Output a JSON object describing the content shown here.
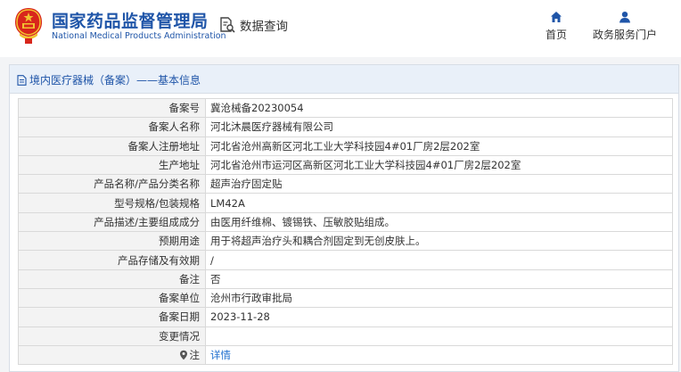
{
  "header": {
    "brand_cn": "国家药品监督管理局",
    "brand_en": "National Medical Products Administration",
    "query_label": "数据查询",
    "nav": [
      {
        "label": "首页",
        "icon": "home-icon"
      },
      {
        "label": "政务服务门户",
        "icon": "user-icon"
      }
    ]
  },
  "panel": {
    "title": "境内医疗器械（备案）——基本信息",
    "rows": [
      {
        "label": "备案号",
        "value": "冀沧械备20230054"
      },
      {
        "label": "备案人名称",
        "value": "河北沐晨医疗器械有限公司"
      },
      {
        "label": "备案人注册地址",
        "value": "河北省沧州高新区河北工业大学科技园4#01厂房2层202室"
      },
      {
        "label": "生产地址",
        "value": "河北省沧州市运河区高新区河北工业大学科技园4#01厂房2层202室"
      },
      {
        "label": "产品名称/产品分类名称",
        "value": "超声治疗固定贴"
      },
      {
        "label": "型号规格/包装规格",
        "value": "LM42A"
      },
      {
        "label": "产品描述/主要组成成分",
        "value": "由医用纤维棉、镀锡铁、压敏胶贴组成。"
      },
      {
        "label": "预期用途",
        "value": "用于将超声治疗头和耦合剂固定到无创皮肤上。"
      },
      {
        "label": "产品存储及有效期",
        "value": "/"
      },
      {
        "label": "备注",
        "value": "否"
      },
      {
        "label": "备案单位",
        "value": "沧州市行政审批局"
      },
      {
        "label": "备案日期",
        "value": "2023-11-28"
      },
      {
        "label": "变更情况",
        "value": ""
      }
    ],
    "note_row": {
      "label": "注",
      "link": "详情"
    }
  },
  "colors": {
    "brand_blue": "#1f55a8",
    "link_blue": "#1f6fcf",
    "emblem_red": "#d8261c",
    "emblem_gold": "#f2c230",
    "panel_head_bg": "#e9f0f9"
  }
}
